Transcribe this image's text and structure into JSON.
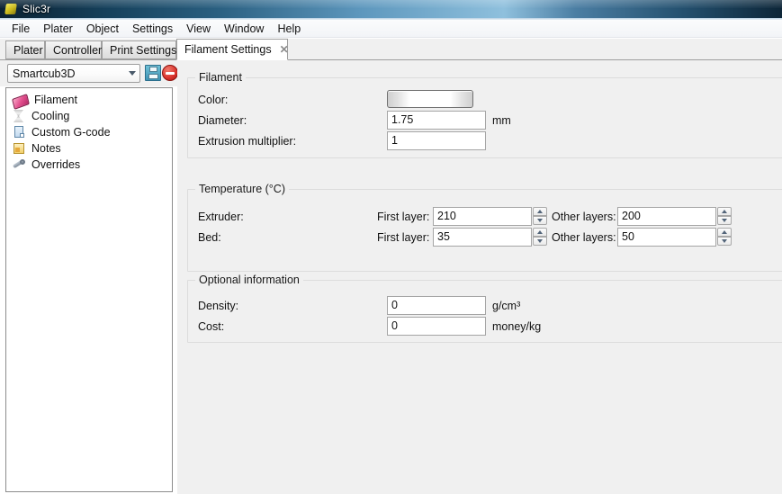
{
  "window": {
    "title": "Slic3r",
    "app_icon": "slic3r-logo-icon"
  },
  "menubar": {
    "items": [
      {
        "label": "File"
      },
      {
        "label": "Plater"
      },
      {
        "label": "Object"
      },
      {
        "label": "Settings"
      },
      {
        "label": "View"
      },
      {
        "label": "Window"
      },
      {
        "label": "Help"
      }
    ]
  },
  "tabs": {
    "items": [
      {
        "label": "Plater",
        "active": false
      },
      {
        "label": "Controller",
        "active": false
      },
      {
        "label": "Print Settings",
        "active": false
      },
      {
        "label": "Filament Settings",
        "active": true
      }
    ],
    "close_label": "✕"
  },
  "preset": {
    "selected": "Smartcub3D",
    "save_icon": "floppy-disk-save-icon",
    "delete_icon": "delete-no-entry-icon"
  },
  "sidebar": {
    "items": [
      {
        "label": "Filament",
        "icon": "filament-spool-icon",
        "selected": true
      },
      {
        "label": "Cooling",
        "icon": "hourglass-cooling-icon",
        "selected": false
      },
      {
        "label": "Custom G-code",
        "icon": "page-gcode-icon",
        "selected": false
      },
      {
        "label": "Notes",
        "icon": "yellow-note-icon",
        "selected": false
      },
      {
        "label": "Overrides",
        "icon": "wrench-overrides-icon",
        "selected": false
      }
    ]
  },
  "sections": {
    "filament": {
      "title": "Filament",
      "color": {
        "label": "Color:",
        "value": "#ffffff"
      },
      "diameter": {
        "label": "Diameter:",
        "value": "1.75",
        "unit": "mm"
      },
      "extrusion_multiplier": {
        "label": "Extrusion multiplier:",
        "value": "1",
        "unit": ""
      }
    },
    "temperature": {
      "title": "Temperature (°C)",
      "extruder": {
        "label": "Extruder:",
        "first_layer_label": "First layer:",
        "first_layer_value": "210",
        "other_layers_label": "Other layers:",
        "other_layers_value": "200"
      },
      "bed": {
        "label": "Bed:",
        "first_layer_label": "First layer:",
        "first_layer_value": "35",
        "other_layers_label": "Other layers:",
        "other_layers_value": "50"
      }
    },
    "optional": {
      "title": "Optional information",
      "density": {
        "label": "Density:",
        "value": "0",
        "unit": "g/cm³"
      },
      "cost": {
        "label": "Cost:",
        "value": "0",
        "unit": "money/kg"
      }
    }
  },
  "colors": {
    "titlebar_accent": "#2a5f80",
    "panel_bg": "#f0f0f0",
    "field_bg": "#ffffff",
    "groupbox_border": "#dcdcdc"
  }
}
